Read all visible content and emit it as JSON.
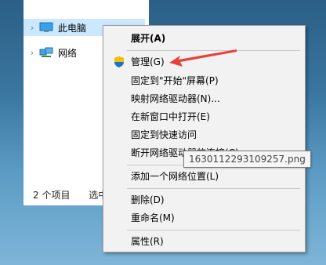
{
  "explorer": {
    "tree": [
      {
        "label": "此电脑",
        "icon": "computer-icon",
        "expander": "›"
      },
      {
        "label": "网络",
        "icon": "network-icon",
        "expander": "›"
      }
    ],
    "status": {
      "count": "2 个项目",
      "selected": "选中"
    }
  },
  "menu": {
    "items": [
      {
        "label": "展开(A)",
        "bold": true
      },
      {
        "label": "管理(G)",
        "icon": "uac-shield-icon"
      },
      {
        "label": "固定到\"开始\"屏幕(P)"
      },
      {
        "label": "映射网络驱动器(N)..."
      },
      {
        "label": "在新窗口中打开(E)"
      },
      {
        "label": "固定到快速访问"
      },
      {
        "label": "断开网络驱动器的连接(C)"
      },
      {
        "label": "添加一个网络位置(L)"
      },
      {
        "label": "删除(D)"
      },
      {
        "label": "重命名(M)"
      },
      {
        "label": "属性(R)"
      }
    ]
  },
  "tooltip": {
    "text": "1630112293109257.png"
  },
  "annotation": {
    "arrow_color": "#e8403a"
  }
}
